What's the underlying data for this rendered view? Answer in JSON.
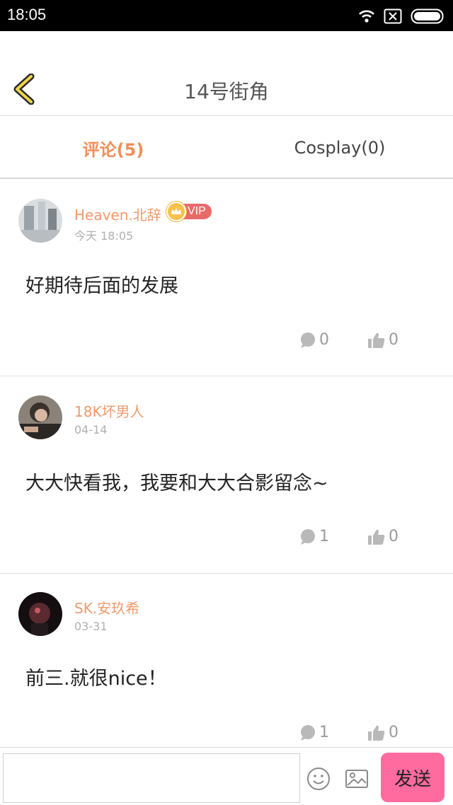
{
  "status_bar": {
    "time": "18:05",
    "icons": [
      "wifi-icon",
      "no-sim-icon",
      "battery-icon"
    ]
  },
  "header": {
    "title": "14号街角",
    "back_icon": "chevron-left-icon"
  },
  "tabs": [
    {
      "label": "评论(5)",
      "active": true
    },
    {
      "label": "Cosplay(0)",
      "active": false
    }
  ],
  "comments": [
    {
      "username": "Heaven.北辞",
      "vip": true,
      "vip_label": "VIP",
      "date": "今天 18:05",
      "text": "好期待后面的发展",
      "replies": "0",
      "likes": "0"
    },
    {
      "username": "18K坏男人",
      "vip": false,
      "date": "04-14",
      "text": "大大快看我，我要和大大合影留念~",
      "replies": "1",
      "likes": "0"
    },
    {
      "username": "SK.安玖希",
      "vip": false,
      "date": "03-31",
      "text": "前三.就很nice！",
      "replies": "1",
      "likes": "0"
    }
  ],
  "composer": {
    "placeholder": "",
    "send_label": "发送"
  },
  "colors": {
    "accent": "#f08f5a",
    "send_button": "#ff6b9e",
    "vip_badge": "#e86a6a"
  }
}
